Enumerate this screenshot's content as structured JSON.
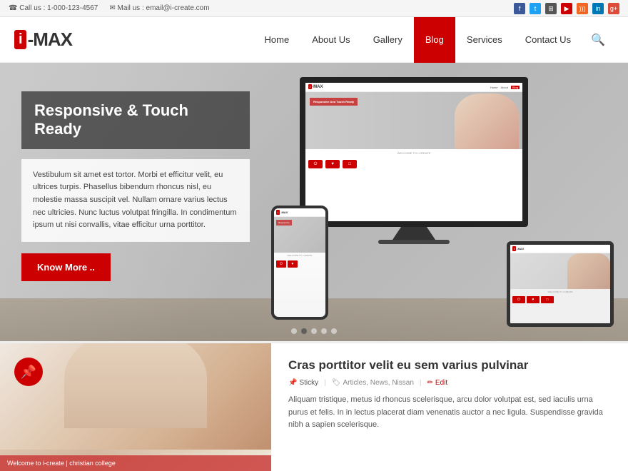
{
  "topbar": {
    "phone": "Call us : 1-000-123-4567",
    "email": "Mail us : email@i-create.com",
    "phone_icon": "☎",
    "email_icon": "✉"
  },
  "header": {
    "logo_i": "i",
    "logo_text": "-MAX",
    "nav": {
      "items": [
        {
          "label": "Home",
          "active": false
        },
        {
          "label": "About Us",
          "active": false
        },
        {
          "label": "Gallery",
          "active": false
        },
        {
          "label": "Blog",
          "active": true
        },
        {
          "label": "Services",
          "active": false
        },
        {
          "label": "Contact Us",
          "active": false
        }
      ]
    }
  },
  "hero": {
    "title": "Responsive & Touch Ready",
    "body_text": "Vestibulum sit amet est tortor. Morbi et efficitur velit, eu ultrices turpis. Phasellus bibendum rhoncus nisl, eu molestie massa suscipit vel. Nullam ornare varius lectus nec ultricies. Nunc luctus volutpat fringilla. In condimentum ipsum ut nisi convallis, vitae efficitur urna porttitor.",
    "cta_label": "Know More ..",
    "screen_title": "Responsive And Touch Ready",
    "screen_welcome": "WELCOME TO I-CREATE",
    "dots": [
      "●",
      "●",
      "●",
      "●",
      "●"
    ]
  },
  "blog": {
    "image_text": "Welcome to i-create | christian college",
    "title": "Cras porttitor velit eu sem varius pulvinar",
    "meta": {
      "sticky": "Sticky",
      "tags": "Articles, News, Nissan",
      "edit": "Edit",
      "pin_icon": "📌",
      "tag_icon": "🏷",
      "edit_icon": "✏"
    },
    "excerpt": "Aliquam tristique, metus id rhoncus scelerisque, arcu dolor volutpat est, sed iaculis urna purus et felis. In in lectus placerat diam venenatis auctor a nec ligula. Suspendisse gravida nibh a sapien scelerisque."
  },
  "social": {
    "icons": [
      "f",
      "t",
      "y",
      "r",
      "l",
      "g+",
      "@"
    ]
  }
}
